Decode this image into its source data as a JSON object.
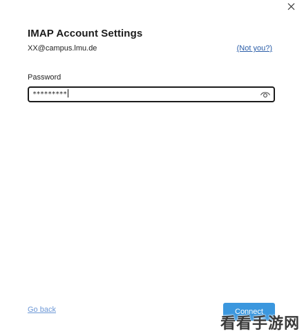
{
  "dialog": {
    "title": "IMAP Account Settings",
    "email": "XX@campus.lmu.de",
    "not_you_link": "(Not you?)",
    "close_icon": "close-icon"
  },
  "password": {
    "label": "Password",
    "masked_value": "*********",
    "reveal_icon": "eye-icon"
  },
  "footer": {
    "go_back_link": "Go back",
    "connect_button": "Connect"
  },
  "colors": {
    "accent": "#1a86d9",
    "link": "#2a5da8",
    "link_faded": "#6b97d6",
    "border": "#1b1b1b"
  },
  "watermark": "看看手游网"
}
